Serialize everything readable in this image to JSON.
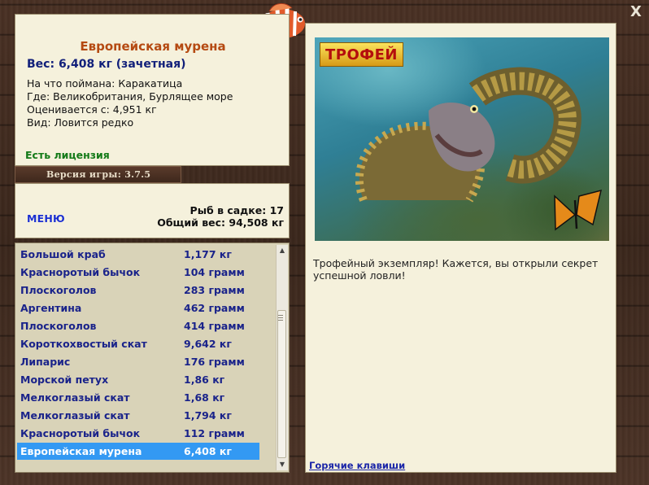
{
  "fish": {
    "name": "Европейская мурена",
    "weight": "Вес: 6,408 кг (зачетная)",
    "caught_on": "На что поймана: Каракатица",
    "location": "Где: Великобритания, Бурлящее море",
    "valued_from": "Оценивается с: 4,951 кг",
    "rarity": "Вид: Ловится редко"
  },
  "license": "Есть лицензия",
  "version": "Версия игры: 3.7.5",
  "menu_label": "МЕНЮ",
  "stats": {
    "fish_in_keepnet": "Рыб в садке: 17",
    "total_weight": "Общий вес: 94,508 кг"
  },
  "catch_list": [
    {
      "name": "Большой краб",
      "weight": "1,177 кг"
    },
    {
      "name": "Красноротый бычок",
      "weight": "104 грамм"
    },
    {
      "name": "Плоскоголов",
      "weight": "283 грамм"
    },
    {
      "name": "Аргентина",
      "weight": "462 грамм"
    },
    {
      "name": "Плоскоголов",
      "weight": "414 грамм"
    },
    {
      "name": "Короткохвостый скат",
      "weight": "9,642 кг"
    },
    {
      "name": "Липарис",
      "weight": "176 грамм"
    },
    {
      "name": "Морской петух",
      "weight": "1,86 кг"
    },
    {
      "name": "Мелкоглазый скат",
      "weight": "1,68 кг"
    },
    {
      "name": "Мелкоглазый скат",
      "weight": "1,794 кг"
    },
    {
      "name": "Красноротый бычок",
      "weight": "112 грамм"
    },
    {
      "name": "Европейская мурена",
      "weight": "6,408 кг"
    }
  ],
  "selected_index": 11,
  "trophy_badge": "ТРОФЕЙ",
  "trophy_caption": "Трофейный экземпляр! Кажется, вы открыли секрет успешной ловли!",
  "hotkeys_link": "Горячие клавиши",
  "close_symbol": "X",
  "colors": {
    "fish_name": "#b54a12",
    "weight": "#12207a",
    "license": "#137a18",
    "list_text": "#1a238a",
    "selection": "#3399f3",
    "panel_bg": "#f5f1dc"
  }
}
